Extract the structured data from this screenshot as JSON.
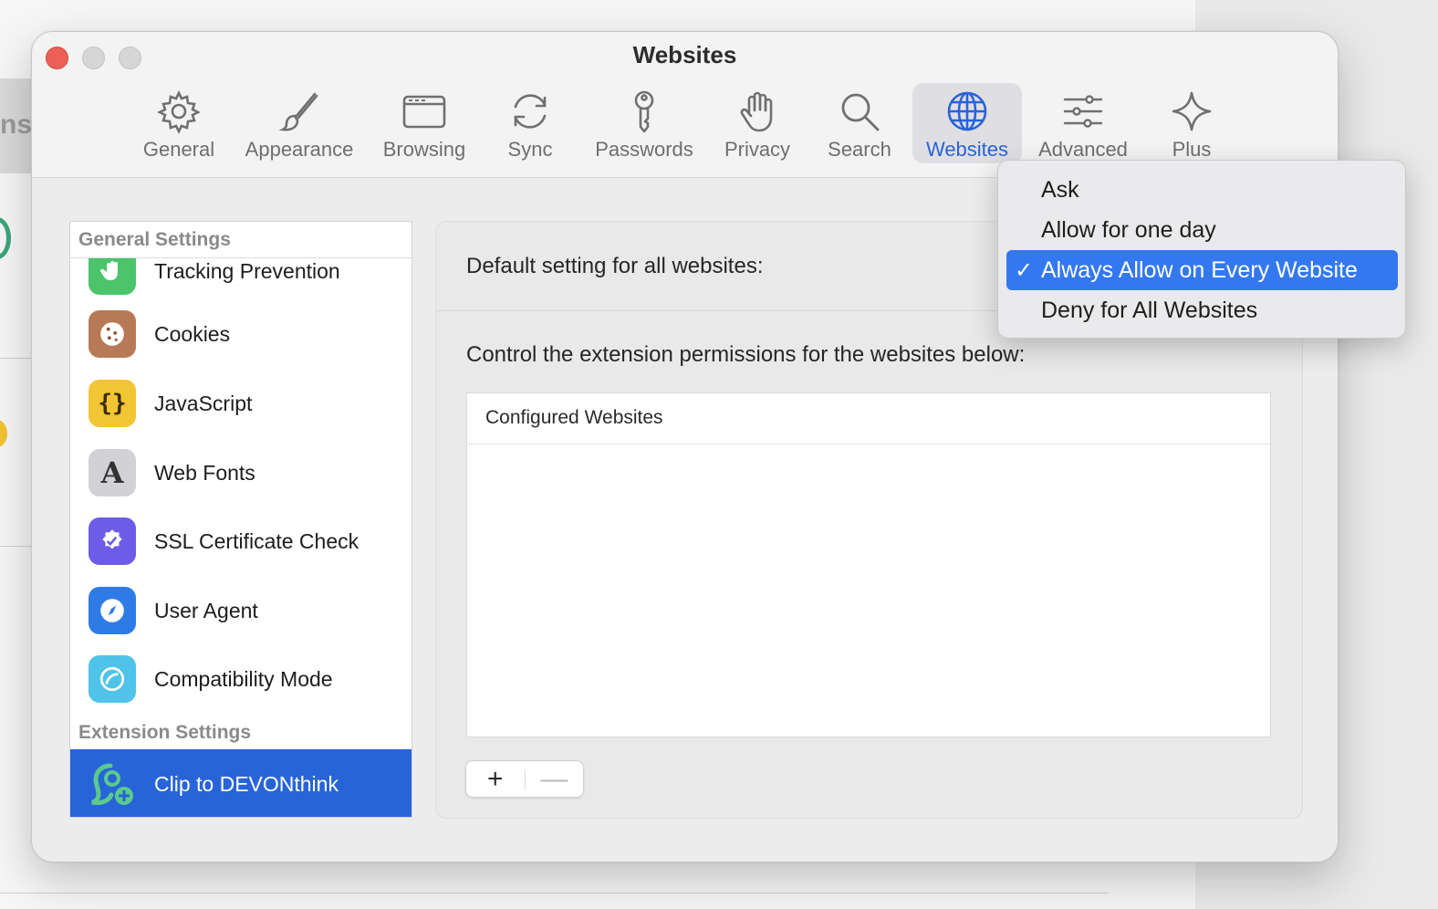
{
  "background": {
    "partial_text": "ns"
  },
  "window": {
    "title": "Websites"
  },
  "toolbar": {
    "tabs": [
      {
        "label": "General",
        "icon": "gear-icon"
      },
      {
        "label": "Appearance",
        "icon": "paintbrush-icon"
      },
      {
        "label": "Browsing",
        "icon": "browser-window-icon"
      },
      {
        "label": "Sync",
        "icon": "sync-icon"
      },
      {
        "label": "Passwords",
        "icon": "key-icon"
      },
      {
        "label": "Privacy",
        "icon": "hand-icon"
      },
      {
        "label": "Search",
        "icon": "magnifier-icon"
      },
      {
        "label": "Websites",
        "icon": "globe-icon",
        "active": true
      },
      {
        "label": "Advanced",
        "icon": "sliders-icon"
      },
      {
        "label": "Plus",
        "icon": "sparkle-icon"
      }
    ]
  },
  "sidebar": {
    "general_header": "General Settings",
    "extension_header": "Extension Settings",
    "items": [
      {
        "label": "Tracking Prevention",
        "icon": "hand-icon"
      },
      {
        "label": "Cookies",
        "icon": "cookie-icon"
      },
      {
        "label": "JavaScript",
        "icon": "braces-icon"
      },
      {
        "label": "Web Fonts",
        "icon": "letter-a-icon"
      },
      {
        "label": "SSL Certificate Check",
        "icon": "shield-check-icon"
      },
      {
        "label": "User Agent",
        "icon": "compass-icon"
      },
      {
        "label": "Compatibility Mode",
        "icon": "compatibility-icon"
      }
    ],
    "extension_items": [
      {
        "label": "Clip to DEVONthink",
        "icon": "devonthink-icon",
        "selected": true
      }
    ]
  },
  "panel": {
    "default_label": "Default setting for all websites:",
    "control_label": "Control the extension permissions for the websites below:",
    "table_header": "Configured Websites",
    "add_button": "+",
    "remove_button": "—"
  },
  "menu": {
    "options": [
      {
        "label": "Ask",
        "selected": false
      },
      {
        "label": "Allow for one day",
        "selected": false
      },
      {
        "label": "Always Allow on Every Website",
        "selected": true
      },
      {
        "label": "Deny for All Websites",
        "selected": false
      }
    ],
    "check_glyph": "✓"
  },
  "colors": {
    "accent": "#2764d8",
    "menu_highlight": "#3478f0",
    "close_button": "#ed5f57"
  }
}
